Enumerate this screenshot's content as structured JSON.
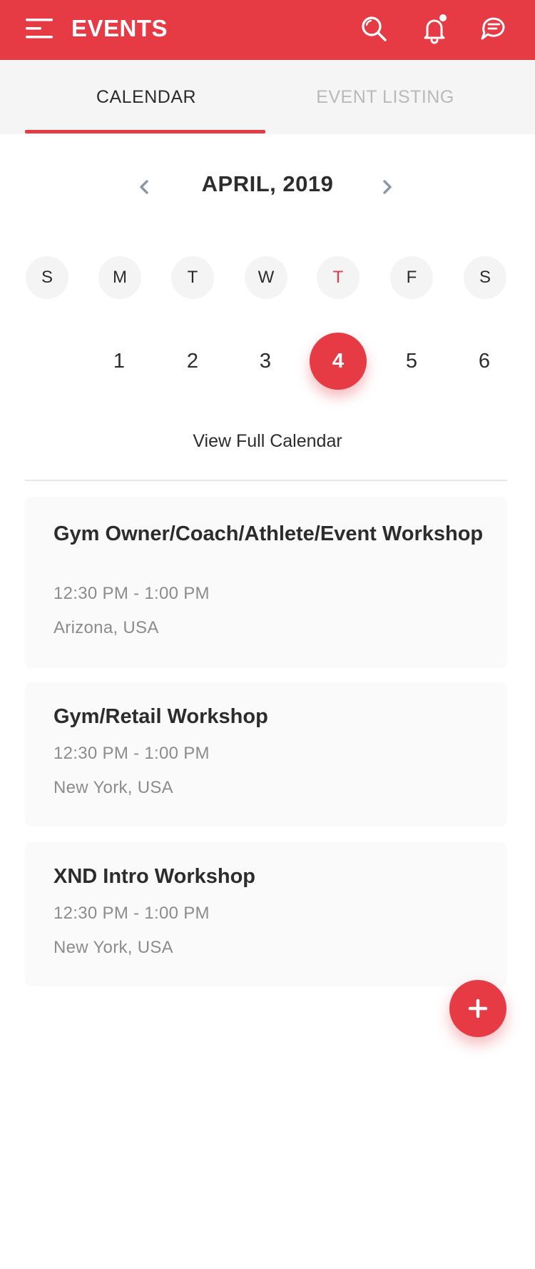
{
  "header": {
    "title": "EVENTS",
    "background": "#e63a44",
    "icons": [
      "menu-icon",
      "search-icon",
      "bell-icon",
      "chat-icon"
    ],
    "notification_dot": true
  },
  "tabs": [
    {
      "label": "CALENDAR",
      "active": true
    },
    {
      "label": "EVENT LISTING",
      "active": false
    }
  ],
  "calendar": {
    "month_label": "APRIL, 2019",
    "weekdays": [
      "S",
      "M",
      "T",
      "W",
      "T",
      "F",
      "S"
    ],
    "today_weekday_index": 4,
    "dates": [
      "",
      "1",
      "2",
      "3",
      "4",
      "5",
      "6"
    ],
    "selected_date": "4",
    "view_full_label": "View Full Calendar"
  },
  "events": [
    {
      "title": "Gym Owner/Coach/Athlete/Event Workshop",
      "time": "12:30 PM - 1:00 PM",
      "location": "Arizona, USA"
    },
    {
      "title": "Gym/Retail Workshop",
      "time": "12:30 PM - 1:00 PM",
      "location": "New York, USA"
    },
    {
      "title": "XND Intro Workshop",
      "time": "12:30 PM - 1:00 PM",
      "location": "New York, USA"
    }
  ],
  "fab": {
    "icon": "plus-icon"
  },
  "colors": {
    "accent": "#e63a44",
    "text": "#2c2c2c",
    "muted": "#8c8c8c",
    "inactive_tab": "#b9b9b9"
  }
}
